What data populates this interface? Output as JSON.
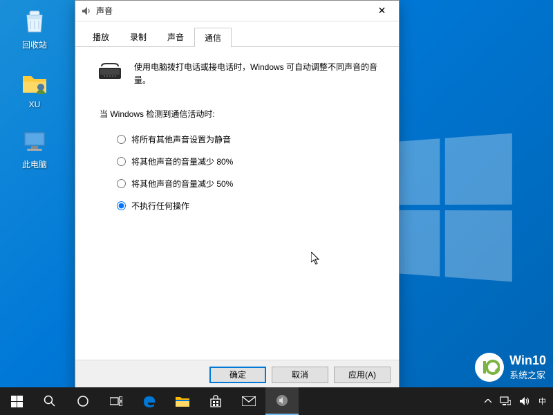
{
  "desktop": {
    "icons": [
      {
        "name": "recycle-bin",
        "label": "回收站"
      },
      {
        "name": "user-folder",
        "label": "XU"
      },
      {
        "name": "this-pc",
        "label": "此电脑"
      }
    ]
  },
  "dialog": {
    "title": "声音",
    "tabs": [
      "播放",
      "录制",
      "声音",
      "通信"
    ],
    "active_tab": 3,
    "info_text": "使用电脑拨打电话或接电话时，Windows 可自动调整不同声音的音量。",
    "section_label": "当 Windows 检测到通信活动时:",
    "radio_options": [
      "将所有其他声音设置为静音",
      "将其他声音的音量减少 80%",
      "将其他声音的音量减少 50%",
      "不执行任何操作"
    ],
    "selected_radio": 3,
    "buttons": {
      "ok": "确定",
      "cancel": "取消",
      "apply": "应用(A)"
    }
  },
  "watermark": {
    "logo_text": "I0",
    "line1": "Win10",
    "line2": "系统之家"
  }
}
